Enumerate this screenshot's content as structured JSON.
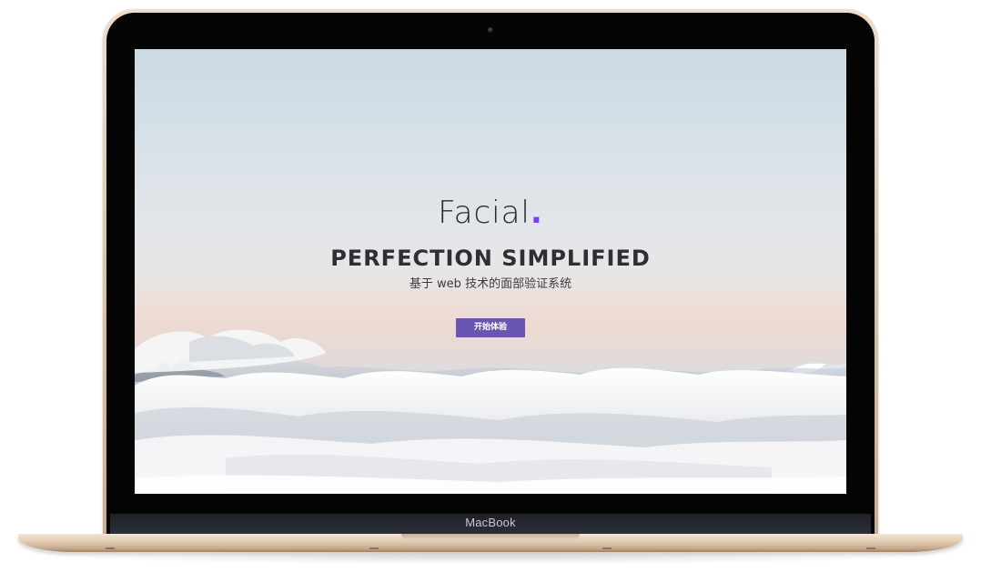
{
  "device": {
    "brand_label": "MacBook"
  },
  "site": {
    "logo_text": "Facial",
    "logo_dot": ".",
    "headline": "PERFECTION SIMPLIFIED",
    "subtitle": "基于 web 技术的面部验证系统",
    "cta_label": "开始体验"
  },
  "colors": {
    "accent": "#7a3ff2",
    "button": "#6a55b2",
    "heading": "#2e2e33",
    "device_frame": "#d9c0a6"
  }
}
